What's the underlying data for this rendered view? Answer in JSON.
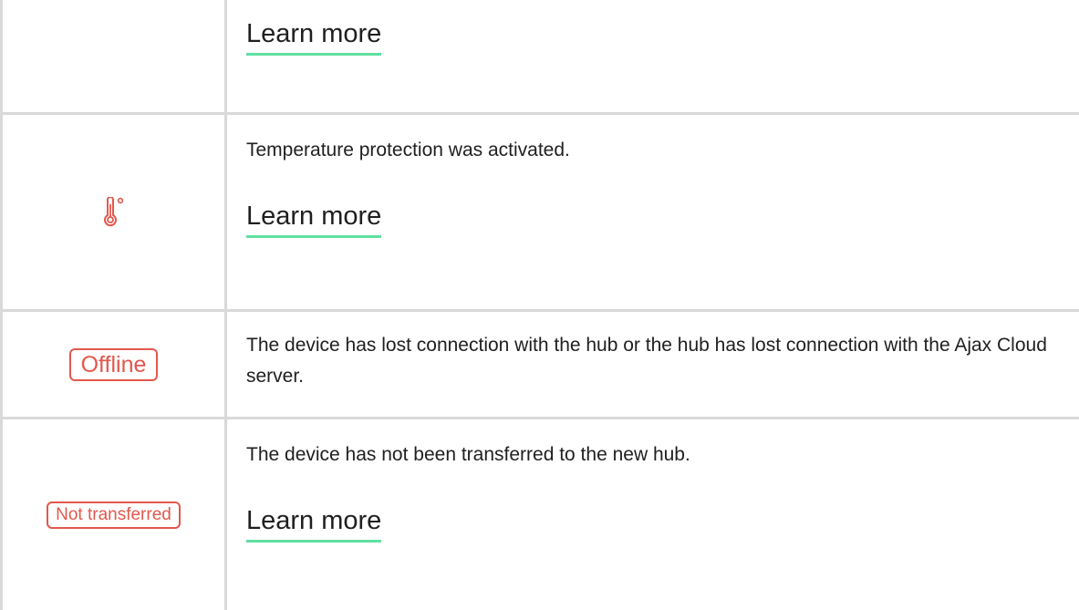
{
  "rows": [
    {
      "learn_more": "Learn more"
    },
    {
      "icon": "thermometer-degree-icon",
      "description": "Temperature protection was activated.",
      "learn_more": "Learn more"
    },
    {
      "badge": "Offline",
      "description": "The device has lost connection with the hub or the hub has lost connection with the Ajax Cloud server."
    },
    {
      "badge": "Not transferred",
      "description": "The device has not been transferred to the new hub.",
      "learn_more": "Learn more"
    }
  ],
  "colors": {
    "alert": "#e2584d",
    "link_underline": "#5fe0a0",
    "grid": "#d9d9d9",
    "text": "#1f1f1f"
  }
}
